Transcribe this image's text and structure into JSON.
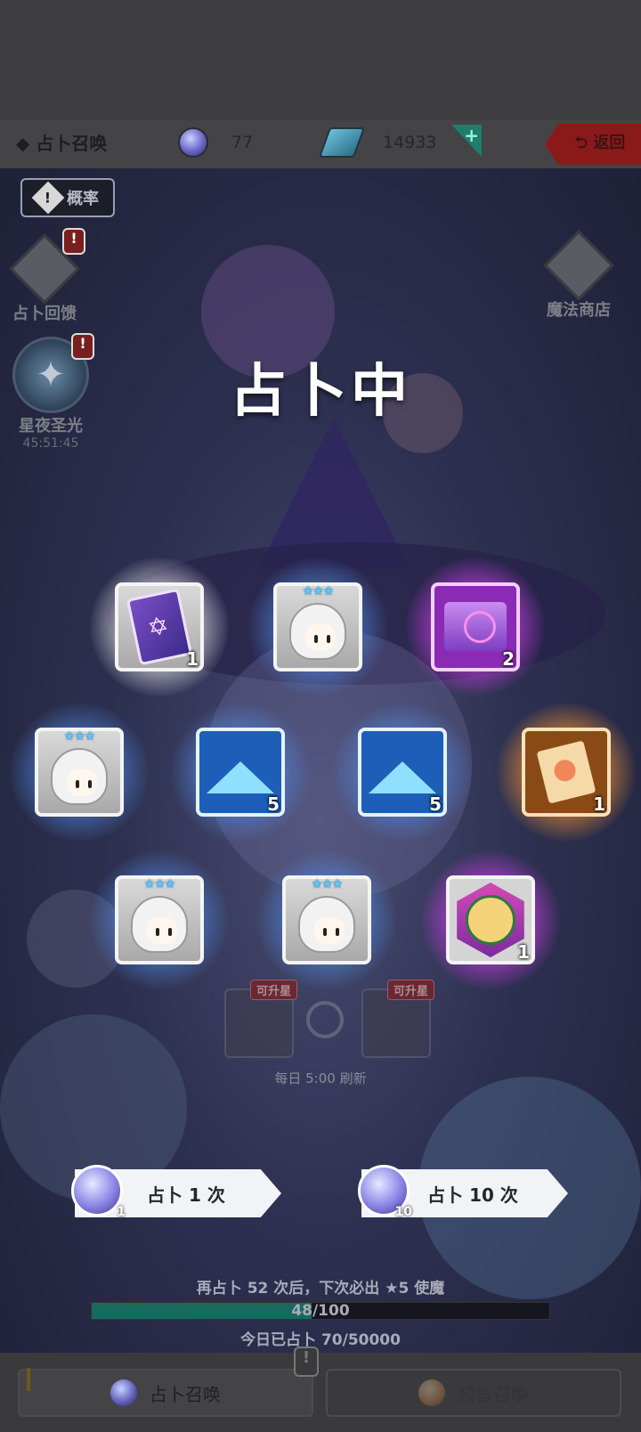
{
  "header": {
    "title": "◆ 占卜召唤",
    "orb_count": "77",
    "crystal_count": "14933",
    "plus_label": "+",
    "back_label": "⮌ 返回"
  },
  "side": {
    "probability_label": "概率",
    "feedback_label": "占卜回馈",
    "feedback_badge": "!",
    "starlight_label": "星夜圣光",
    "starlight_timer": "45:51:45",
    "starlight_badge": "!",
    "shop_label": "魔法商店"
  },
  "status_text": "占卜中",
  "rewards": [
    {
      "id": "tarot-card",
      "count": "1",
      "stars": ""
    },
    {
      "id": "maid-character",
      "count": "",
      "stars": "★★★"
    },
    {
      "id": "magic-scroll",
      "count": "2",
      "stars": ""
    },
    {
      "id": "maid-character",
      "count": "",
      "stars": "★★★"
    },
    {
      "id": "crystal-salt",
      "count": "5",
      "stars": ""
    },
    {
      "id": "crystal-salt",
      "count": "5",
      "stars": ""
    },
    {
      "id": "treasure-paper",
      "count": "1",
      "stars": ""
    },
    {
      "id": "maid-character",
      "count": "",
      "stars": "★★★"
    },
    {
      "id": "maid-character",
      "count": "",
      "stars": "★★★"
    },
    {
      "id": "golden-knight",
      "count": "1",
      "stars": ""
    }
  ],
  "preview": {
    "upgrade_label": "可升星",
    "upgrade_label_2": "可升星",
    "refresh_text": "每日 5:00 刷新"
  },
  "summon": {
    "single_label": "占卜 1 次",
    "single_cost": "1",
    "ten_label": "占卜 10 次",
    "ten_cost": "10"
  },
  "pity": {
    "text": "再占卜 52 次后，下次必出 ★5 使魔",
    "progress_label": "48/100",
    "progress_value": 0.48,
    "today_text": "今日已占卜 70/50000"
  },
  "tabs": {
    "active_label": "占卜召唤",
    "inactive_label": "预言召唤",
    "badge": "!"
  },
  "colors": {
    "progress_fill": "#166a5e",
    "back_button": "#8a1a1a"
  }
}
